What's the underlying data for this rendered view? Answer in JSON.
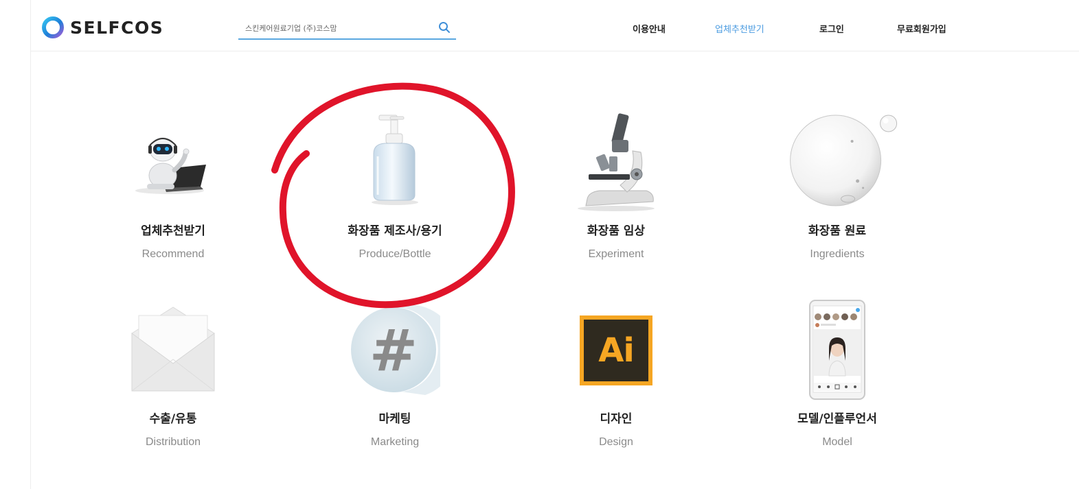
{
  "header": {
    "logo_text": "SELFCOS",
    "search": {
      "placeholder": "스킨케어원료기업 (주)코스맘"
    },
    "nav": [
      "이용안내",
      "업체추천받기",
      "로그인",
      "무료회원가입"
    ],
    "nav_active_index": 1
  },
  "categories": [
    {
      "kr": "업체추천받기",
      "en": "Recommend",
      "icon": "robot-laptop-icon"
    },
    {
      "kr": "화장품 제조사/용기",
      "en": "Produce/Bottle",
      "icon": "pump-bottle-icon"
    },
    {
      "kr": "화장품 임상",
      "en": "Experiment",
      "icon": "microscope-icon"
    },
    {
      "kr": "화장품 원료",
      "en": "Ingredients",
      "icon": "bubble-icon"
    },
    {
      "kr": "수출/유통",
      "en": "Distribution",
      "icon": "envelope-icon"
    },
    {
      "kr": "마케팅",
      "en": "Marketing",
      "icon": "hashtag-bubble-icon"
    },
    {
      "kr": "디자인",
      "en": "Design",
      "icon": "illustrator-icon",
      "icon_text": "Ai"
    },
    {
      "kr": "모델/인플루언서",
      "en": "Model",
      "icon": "phone-instagram-icon"
    }
  ],
  "colors": {
    "accent": "#4a9be0",
    "annotation": "#e0142a",
    "ai_bg": "#2f2a1f",
    "ai_fg": "#f6a623"
  }
}
